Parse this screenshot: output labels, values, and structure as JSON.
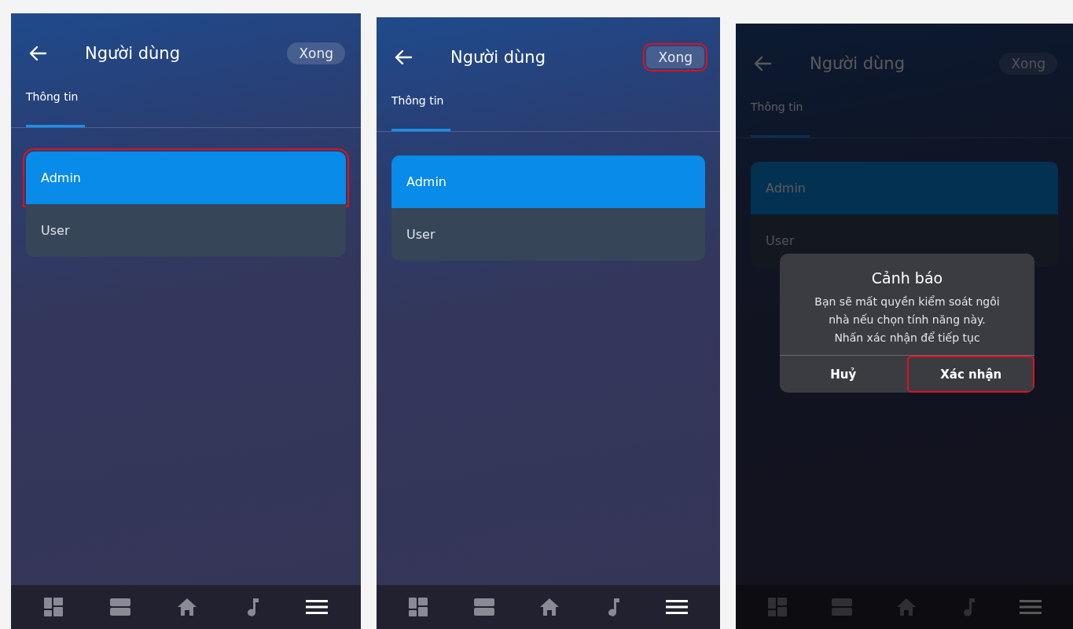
{
  "screens": [
    {
      "header": {
        "title": "Người dùng",
        "done_button": {
          "label": "Xong",
          "highlighted": false
        }
      },
      "tabs": [
        {
          "label": "Thông tin",
          "selected": true
        }
      ],
      "options": [
        {
          "label": "Admin",
          "selected": true,
          "highlighted": true
        },
        {
          "label": "User",
          "selected": false,
          "highlighted": false
        }
      ],
      "nav": [
        {
          "kind": "dashboard",
          "selected": false
        },
        {
          "kind": "rooms",
          "selected": false
        },
        {
          "kind": "home",
          "selected": false
        },
        {
          "kind": "music",
          "selected": false
        },
        {
          "kind": "menu",
          "selected": true
        }
      ],
      "dimmed": false
    },
    {
      "header": {
        "title": "Người dùng",
        "done_button": {
          "label": "Xong",
          "highlighted": true
        }
      },
      "tabs": [
        {
          "label": "Thông tin",
          "selected": true
        }
      ],
      "options": [
        {
          "label": "Admin",
          "selected": true,
          "highlighted": false
        },
        {
          "label": "User",
          "selected": false,
          "highlighted": false
        }
      ],
      "nav": [
        {
          "kind": "dashboard",
          "selected": false
        },
        {
          "kind": "rooms",
          "selected": false
        },
        {
          "kind": "home",
          "selected": false
        },
        {
          "kind": "music",
          "selected": false
        },
        {
          "kind": "menu",
          "selected": true
        }
      ],
      "dimmed": false
    },
    {
      "header": {
        "title": "Người dùng",
        "done_button": {
          "label": "Xong",
          "highlighted": false
        }
      },
      "tabs": [
        {
          "label": "Thông tin",
          "selected": true
        }
      ],
      "options": [
        {
          "label": "Admin",
          "selected": true,
          "highlighted": false
        },
        {
          "label": "User",
          "selected": false,
          "highlighted": false
        }
      ],
      "nav": [
        {
          "kind": "dashboard",
          "selected": false
        },
        {
          "kind": "rooms",
          "selected": false
        },
        {
          "kind": "home",
          "selected": false
        },
        {
          "kind": "music",
          "selected": false
        },
        {
          "kind": "menu",
          "selected": true
        }
      ],
      "dimmed": true,
      "dialog": {
        "title": "Cảnh báo",
        "message": "Bạn sẽ mất quyền kiểm soát ngôi\nnhà nếu chọn tính năng này.\nNhấn xác nhận để tiếp tục",
        "buttons": [
          {
            "label": "Huỷ",
            "highlighted": false
          },
          {
            "label": "Xác nhận",
            "highlighted": true
          }
        ]
      }
    }
  ]
}
